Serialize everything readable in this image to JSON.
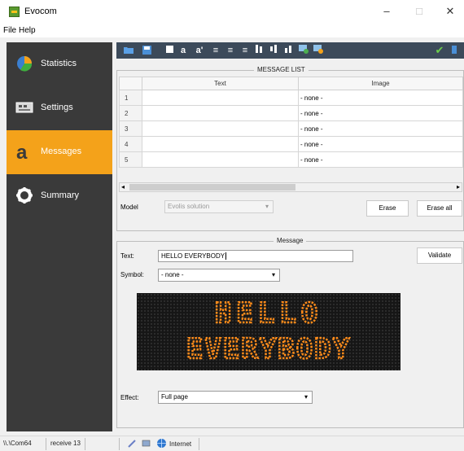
{
  "window": {
    "title": "Evocom",
    "minimize": "–",
    "maximize": "□",
    "close": "✕"
  },
  "menu": [
    "File",
    "Help"
  ],
  "sidebar": {
    "items": [
      {
        "label": "Statistics",
        "icon": "pie-chart-icon"
      },
      {
        "label": "Settings",
        "icon": "printer-settings-icon"
      },
      {
        "label": "Messages",
        "icon": "letter-a-icon"
      },
      {
        "label": "Summary",
        "icon": "gear-icon"
      }
    ],
    "active": "Messages",
    "accent": "#f4a21a",
    "background": "#3a3a3a"
  },
  "toolbar": {
    "background": "#3c4a5a"
  },
  "message_list": {
    "legend": "MESSAGE LIST",
    "columns": [
      "Text",
      "Image"
    ],
    "rows": [
      {
        "n": "1",
        "text": "",
        "image": "- none -"
      },
      {
        "n": "2",
        "text": "",
        "image": "- none -"
      },
      {
        "n": "3",
        "text": "",
        "image": "- none -"
      },
      {
        "n": "4",
        "text": "",
        "image": "- none -"
      },
      {
        "n": "5",
        "text": "",
        "image": "- none -"
      }
    ],
    "model_label": "Model",
    "model_value": "Evolis solution",
    "erase": "Erase",
    "erase_all": "Erase all"
  },
  "message": {
    "legend": "Message",
    "text_label": "Text:",
    "text_value": "HELLO EVERYBODY",
    "validate": "Validate",
    "symbol_label": "Symbol:",
    "symbol_value": "- none -",
    "preview_line1": "HELLO",
    "preview_line2": "EVERYBODY",
    "led_color": "#ff8c1a",
    "effect_label": "Effect:",
    "effect_value": "Full page"
  },
  "status": {
    "path": "\\\\.\\Com64",
    "receive": "receive 13",
    "zone": "Internet"
  }
}
